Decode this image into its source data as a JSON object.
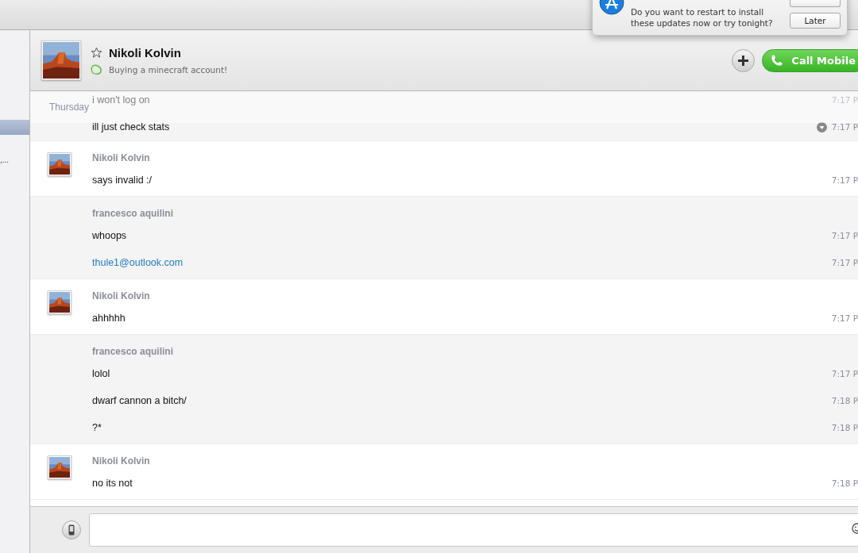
{
  "sidebar": {
    "items": [
      {
        "selected": true
      },
      {
        "label": ",...",
        "selected": false
      }
    ]
  },
  "notification": {
    "message": "Do you want to restart to install these updates now or try tonight?",
    "buttons": [
      "Later"
    ]
  },
  "contact": {
    "name": "Nikoli Kolvin",
    "mood": "Buying a minecraft account!",
    "favorite": false
  },
  "call_button": "Call Mobile",
  "date_header": "Thursday",
  "groups": [
    {
      "messages": [
        {
          "text": "i won't log on",
          "time": "7:17 P",
          "kind": "text",
          "hovered": false
        },
        {
          "text": "ill just check stats",
          "time": "7:17 P",
          "kind": "text",
          "hovered": true
        }
      ]
    },
    {
      "sender": "Nikoli Kolvin",
      "avatar": true,
      "messages": [
        {
          "text": "says invalid :/",
          "time": "7:17 P",
          "kind": "text",
          "hovered": false
        }
      ]
    },
    {
      "sender": "francesco aquilini",
      "avatar": false,
      "messages": [
        {
          "text": "whoops",
          "time": "7:17 P",
          "kind": "text",
          "hovered": false
        },
        {
          "text": "thule1@outlook.com",
          "time": "7:17 P",
          "kind": "link",
          "hovered": false
        }
      ]
    },
    {
      "sender": "Nikoli Kolvin",
      "avatar": true,
      "messages": [
        {
          "text": "ahhhhh",
          "time": "7:17 P",
          "kind": "text",
          "hovered": false
        }
      ]
    },
    {
      "sender": "francesco aquilini",
      "avatar": false,
      "messages": [
        {
          "text": "lolol",
          "time": "7:17 P",
          "kind": "text",
          "hovered": false
        },
        {
          "text": "dwarf cannon a bitch/",
          "time": "7:18 P",
          "kind": "text",
          "hovered": false
        },
        {
          "text": "?*",
          "time": "7:18 P",
          "kind": "text",
          "hovered": false
        }
      ]
    },
    {
      "sender": "Nikoli Kolvin",
      "avatar": true,
      "messages": [
        {
          "text": "no its not",
          "time": "7:18 P",
          "kind": "text",
          "hovered": false
        }
      ]
    }
  ]
}
